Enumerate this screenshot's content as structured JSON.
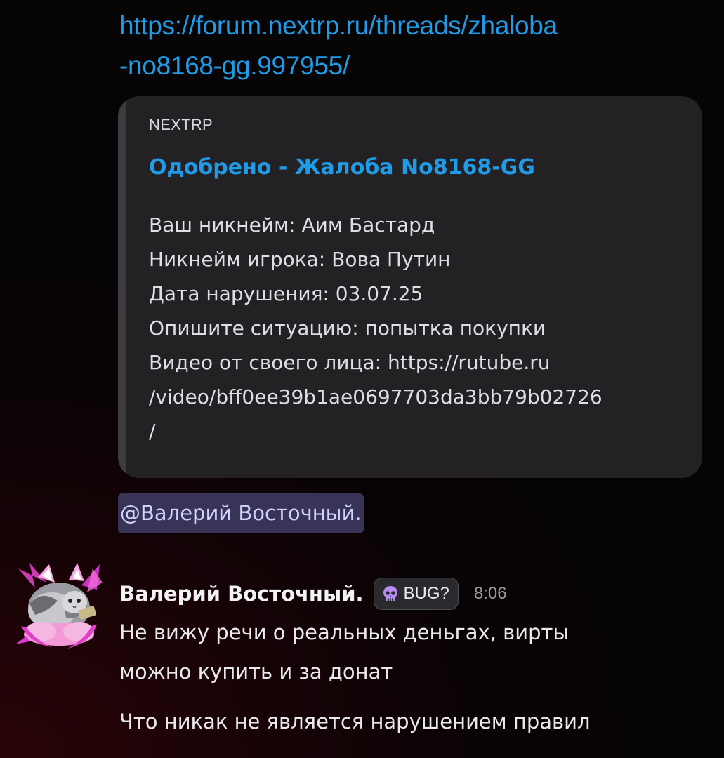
{
  "link": {
    "line1": "https://forum.nextrp.ru/threads/zhaloba",
    "line2": "-no8168-gg.997955/"
  },
  "embed": {
    "provider": "NEXTRP",
    "title": "Одобрено - Жалоба No8168-GG",
    "description_lines": [
      "Ваш никнейм: Аим Бастард",
      "Никнейм игрока: Вова Путин",
      "Дата нарушения: 03.07.25",
      "Опишите ситуацию: попытка покупки",
      "Видео от своего лица: https://rutube.ru",
      "/video/bff0ee39b1ae0697703da3bb79b02726",
      "/"
    ]
  },
  "mention": "@Валерий Восточный.",
  "message": {
    "author": "Валерий Восточный.",
    "badge_label": "BUG?",
    "badge_icon": "skull-icon",
    "timestamp": "8:06",
    "lines_1": [
      "Не вижу речи о реальных деньгах, вирты",
      "можно купить и за донат"
    ],
    "lines_2": [
      "Что никак не является нарушением правил"
    ]
  },
  "colors": {
    "link": "#1f9be8",
    "embed_bg": "#242124",
    "mention_bg": "#3a3358",
    "mention_text": "#cfd3ff"
  }
}
